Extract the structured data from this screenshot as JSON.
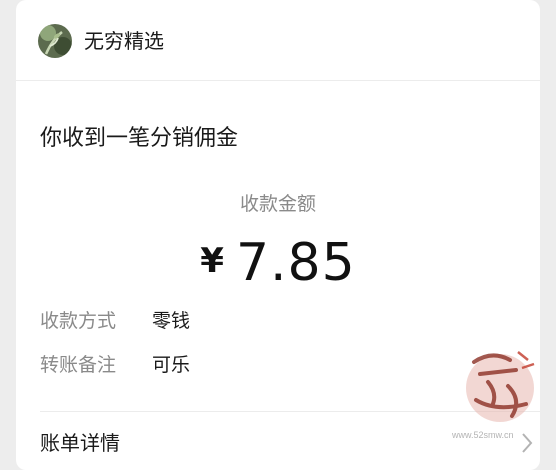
{
  "header": {
    "brand_name": "无穷精选",
    "avatar_icon": "plant-avatar-icon"
  },
  "message": {
    "title": "你收到一笔分销佣金",
    "amount_label": "收款金额",
    "currency": "¥",
    "amount": "7.85"
  },
  "details": [
    {
      "label": "收款方式",
      "value": "零钱"
    },
    {
      "label": "转账备注",
      "value": "可乐"
    }
  ],
  "footer": {
    "bill_details_label": "账单详情",
    "chevron_icon": "chevron-right-icon"
  },
  "watermark": {
    "text": "吾爱首码",
    "url": "www.52smw.cn",
    "color": "#c0392b"
  }
}
